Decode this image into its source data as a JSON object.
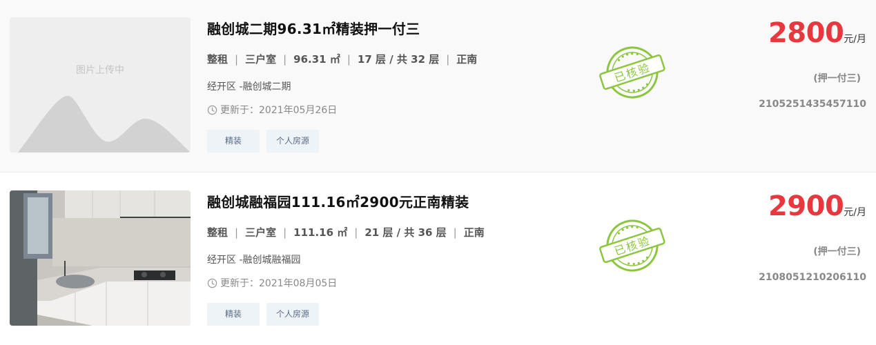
{
  "listings": [
    {
      "image_placeholder": "图片上传中",
      "title": "融创城二期96.31㎡精装押一付三",
      "meta": [
        "整租",
        "三户室",
        "96.31 ㎡",
        "17 层 / 共 32 层",
        "正南"
      ],
      "address": "经开区 -融创城二期",
      "updated": "更新于：2021年05月26日",
      "tags": [
        "精装",
        "个人房源"
      ],
      "stamp_text": "已核验",
      "price": "2800",
      "price_unit": "元/月",
      "deposit": "(押一付三)",
      "code": "2105251435457110"
    },
    {
      "image_placeholder": "",
      "title": "融创城融福园111.16㎡2900元正南精装",
      "meta": [
        "整租",
        "三户室",
        "111.16 ㎡",
        "21 层 / 共 36 层",
        "正南"
      ],
      "address": "经开区 -融创城融福园",
      "updated": "更新于：2021年08月05日",
      "tags": [
        "精装",
        "个人房源"
      ],
      "stamp_text": "已核验",
      "price": "2900",
      "price_unit": "元/月",
      "deposit": "(押一付三)",
      "code": "2108051210206110"
    }
  ],
  "colors": {
    "price": "#e8383d",
    "stamp": "#8cc63f",
    "tag_bg": "#eef3f8",
    "tag_text": "#5a6c86"
  },
  "icons": {
    "updated": "clock-icon",
    "stamp": "verified-stamp-icon"
  }
}
